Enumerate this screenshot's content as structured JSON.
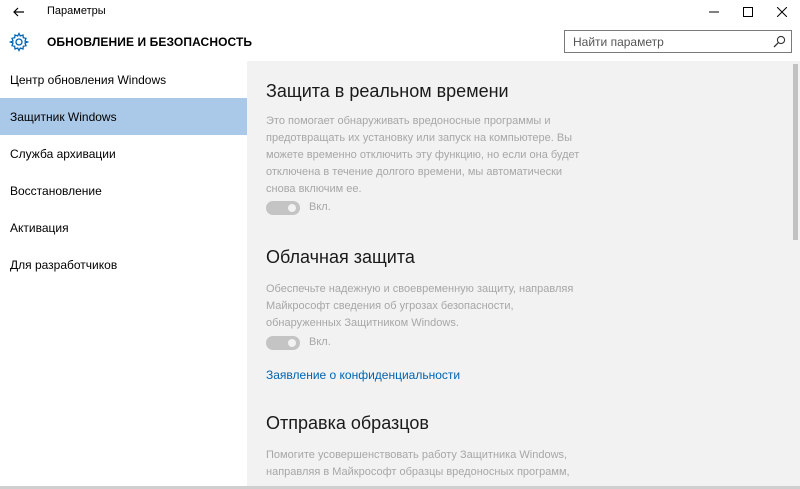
{
  "window": {
    "title": "Параметры"
  },
  "header": {
    "title": "ОБНОВЛЕНИЕ И БЕЗОПАСНОСТЬ",
    "search_placeholder": "Найти параметр"
  },
  "sidebar": {
    "items": [
      {
        "label": "Центр обновления Windows",
        "active": false
      },
      {
        "label": "Защитник Windows",
        "active": true
      },
      {
        "label": "Служба архивации",
        "active": false
      },
      {
        "label": "Восстановление",
        "active": false
      },
      {
        "label": "Активация",
        "active": false
      },
      {
        "label": "Для разработчиков",
        "active": false
      }
    ]
  },
  "content": {
    "realtime": {
      "title": "Защита в реальном времени",
      "lines": [
        "Это помогает обнаруживать вредоносные программы и",
        "предотвращать их установку или запуск на компьютере. Вы",
        "можете временно отключить эту функцию, но если она будет",
        "отключена в течение долгого времени, мы автоматически",
        "снова включим ее."
      ],
      "toggle_label": "Вкл.",
      "toggle_on": true
    },
    "cloud": {
      "title": "Облачная защита",
      "lines": [
        "Обеспечьте надежную и своевременную защиту, направляя",
        "Майкрософт сведения об угрозах безопасности,",
        "обнаруженных Защитником Windows."
      ],
      "toggle_label": "Вкл.",
      "toggle_on": true
    },
    "privacy_link": "Заявление о конфиденциальности",
    "samples": {
      "title": "Отправка образцов",
      "lines": [
        "Помогите усовершенствовать работу Защитника Windows,",
        "направляя в Майкрософт образцы вредоносных программ,"
      ]
    }
  },
  "colors": {
    "accent": "#0063b1",
    "sidebar_active": "#aac8e8",
    "content_bg": "#f2f2f2",
    "disabled_text": "#a7a7a7"
  }
}
